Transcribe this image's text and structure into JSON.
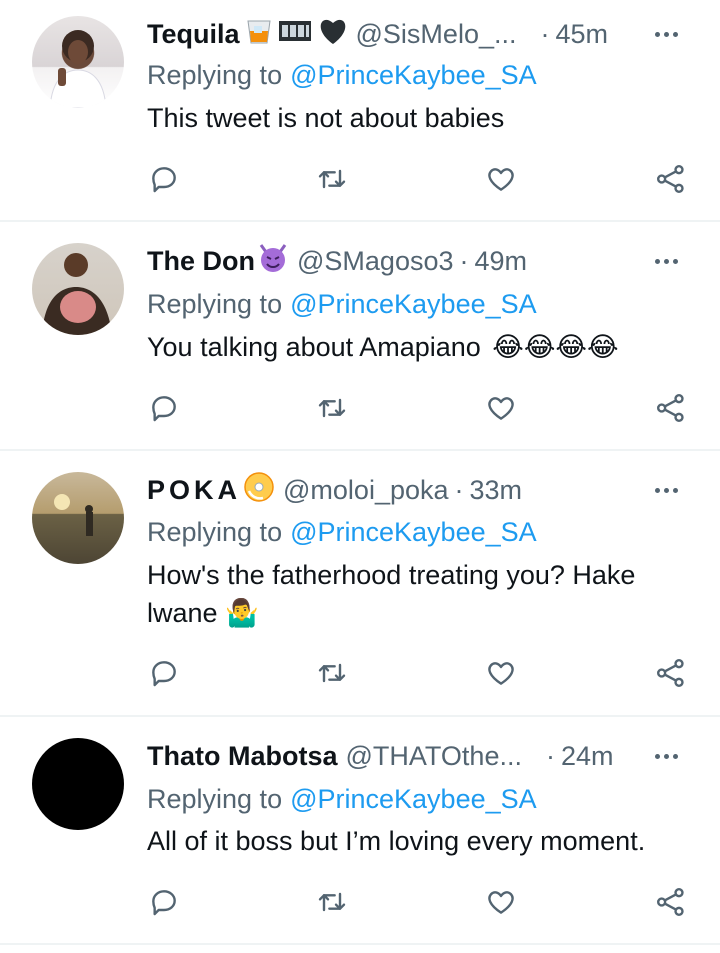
{
  "tweets": [
    {
      "name": "Tequila",
      "name_emojis": [
        "tumbler-glass-emoji",
        "film-frames-emoji",
        "black-heart-emoji"
      ],
      "handle": "@SisMelo_...",
      "dot": "·",
      "time": "45m",
      "replying_prefix": "Replying to",
      "replying_to": "@PrinceKaybee_SA",
      "text": "This tweet is not about babies",
      "text_emojis": []
    },
    {
      "name": "The Don",
      "name_emojis": [
        "smiling-imp-emoji"
      ],
      "handle": "@SMagoso3",
      "dot": "·",
      "time": "49m",
      "replying_prefix": "Replying to",
      "replying_to": "@PrinceKaybee_SA",
      "text": "You talking about Amapiano",
      "text_emojis": [
        "tears-of-joy-emoji",
        "tears-of-joy-emoji",
        "tears-of-joy-emoji",
        "tears-of-joy-emoji"
      ]
    },
    {
      "name": "POKA",
      "name_emojis": [
        "dvd-emoji"
      ],
      "handle": "@moloi_poka",
      "dot": "·",
      "time": "33m",
      "replying_prefix": "Replying to",
      "replying_to": "@PrinceKaybee_SA",
      "text": "How's the fatherhood treating you? Hake lwane",
      "text_emojis": [
        "man-shrugging-emoji"
      ]
    },
    {
      "name": "Thato Mabotsa",
      "name_emojis": [],
      "handle": "@THATOthe...",
      "dot": "·",
      "time": "24m",
      "replying_prefix": "Replying to",
      "replying_to": "@PrinceKaybee_SA",
      "text": "All of it boss but I’m loving every moment.",
      "text_emojis": []
    }
  ],
  "icons": {
    "reply": "reply-icon",
    "retweet": "retweet-icon",
    "like": "heart-icon",
    "share": "share-icon",
    "more": "more-options-icon"
  },
  "colors": {
    "text": "#0f1419",
    "secondary": "#536471",
    "link": "#1d9bf0",
    "divider": "#eff3f4"
  }
}
